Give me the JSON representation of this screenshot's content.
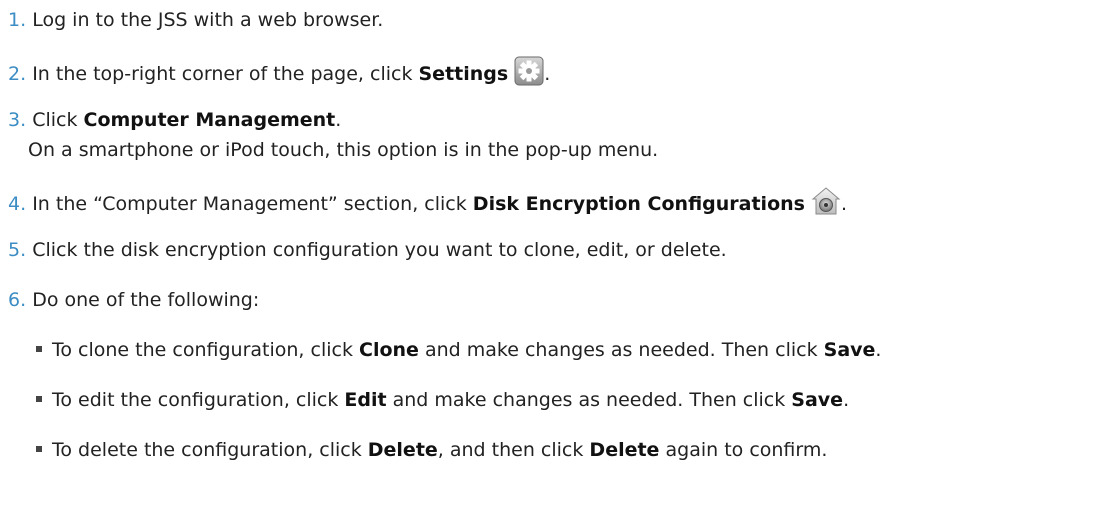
{
  "steps": [
    {
      "num": "1.",
      "text": "Log in to the JSS with a web browser."
    },
    {
      "num": "2.",
      "pre": "In the top-right corner of the page, click ",
      "bold": "Settings",
      "icon": "gear-icon",
      "post": "."
    },
    {
      "num": "3.",
      "pre": "Click ",
      "bold": "Computer Management",
      "post": ".",
      "note": "On a smartphone or iPod touch, this option is in the pop-up menu."
    },
    {
      "num": "4.",
      "pre": "In the “Computer Management” section, click ",
      "bold": "Disk Encryption Configurations",
      "icon": "filevault-house-icon",
      "post": "."
    },
    {
      "num": "5.",
      "text": "Click the disk encryption configuration you want to clone, edit, or delete."
    },
    {
      "num": "6.",
      "text": "Do one of the following:"
    }
  ],
  "bullets": [
    {
      "t1": "To clone the configuration, click ",
      "b1": "Clone",
      "t2": " and make changes as needed. Then click ",
      "b2": "Save",
      "t3": "."
    },
    {
      "t1": "To edit the configuration, click ",
      "b1": "Edit",
      "t2": " and make changes as needed. Then click ",
      "b2": "Save",
      "t3": "."
    },
    {
      "t1": "To delete the configuration, click ",
      "b1": "Delete",
      "t2": ", and then click ",
      "b2": "Delete",
      "t3": " again to confirm."
    }
  ]
}
